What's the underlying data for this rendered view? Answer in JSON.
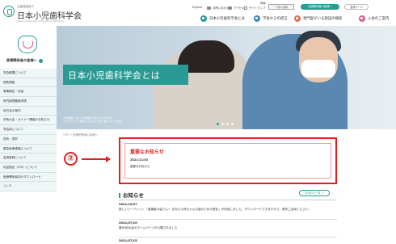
{
  "header": {
    "logo_sub": "公益社団法人",
    "logo_name": "日本小児歯科学会",
    "logo_en": "Japanese Society of Pediatric Dentistry",
    "util": {
      "english": "English",
      "contact": "お問い合わせ",
      "access": "アクセス",
      "sitemap": "サイトマップ",
      "search_label": "検索"
    },
    "search_placeholder": "一般の皆様",
    "member_pill": "医療関係者の皆様へ",
    "mypage_pill": "会員ページ",
    "nav": [
      {
        "label": "日本小児歯科学会とは",
        "color": "#2a9a94"
      },
      {
        "label": "学会からの提言",
        "color": "#3d82c4"
      },
      {
        "label": "専門医がいる施設の検索",
        "color": "#e0704a"
      },
      {
        "label": "入会のご案内",
        "color": "#e05a8a"
      }
    ]
  },
  "sidebar": {
    "caption": "医療関係者の皆様へ",
    "items": [
      "学会概要について",
      "規則規程",
      "事業報告・計画",
      "研究倫理審査申請",
      "地方会の案内",
      "学術大会・セミナー開催のお知らせ",
      "学会誌について",
      "賞状・表彰",
      "緊急医療連絡について",
      "会員登録について",
      "利益相反（COI）について",
      "医療関係者向けダウンロード",
      "リンク"
    ]
  },
  "hero": {
    "title": "日本小児歯科学会とは",
    "note_line1": "学会組織についての情報をご覧いただけます。",
    "note_line2": "ホスピタリティ豊かな子どもたちをご紹介いたします。"
  },
  "breadcrumb": "TOP ＞ 医療関係者の皆様へ",
  "annotation": {
    "marker": "②"
  },
  "notice": {
    "title": "重要なお知らせ",
    "date": "2021/11/30",
    "text": "重要なお知らせ"
  },
  "news": {
    "heading": "お知らせ",
    "list_button": "お知らせ一覧 ＞",
    "items": [
      {
        "date": "2021/10/27",
        "text": "新しいリーフレット「保護者の皆さんへ あなたの赤ちゃんの歯のための提言」が完成しました。ダウンロードできますので、是非ご活用ください。"
      },
      {
        "date": "2021/07/19",
        "text": "第60回大会のホームページが公開されました"
      },
      {
        "date": "2021/07/15",
        "text": ""
      }
    ]
  },
  "colors": {
    "accent": "#2a9a94",
    "alert": "#dd2222"
  }
}
